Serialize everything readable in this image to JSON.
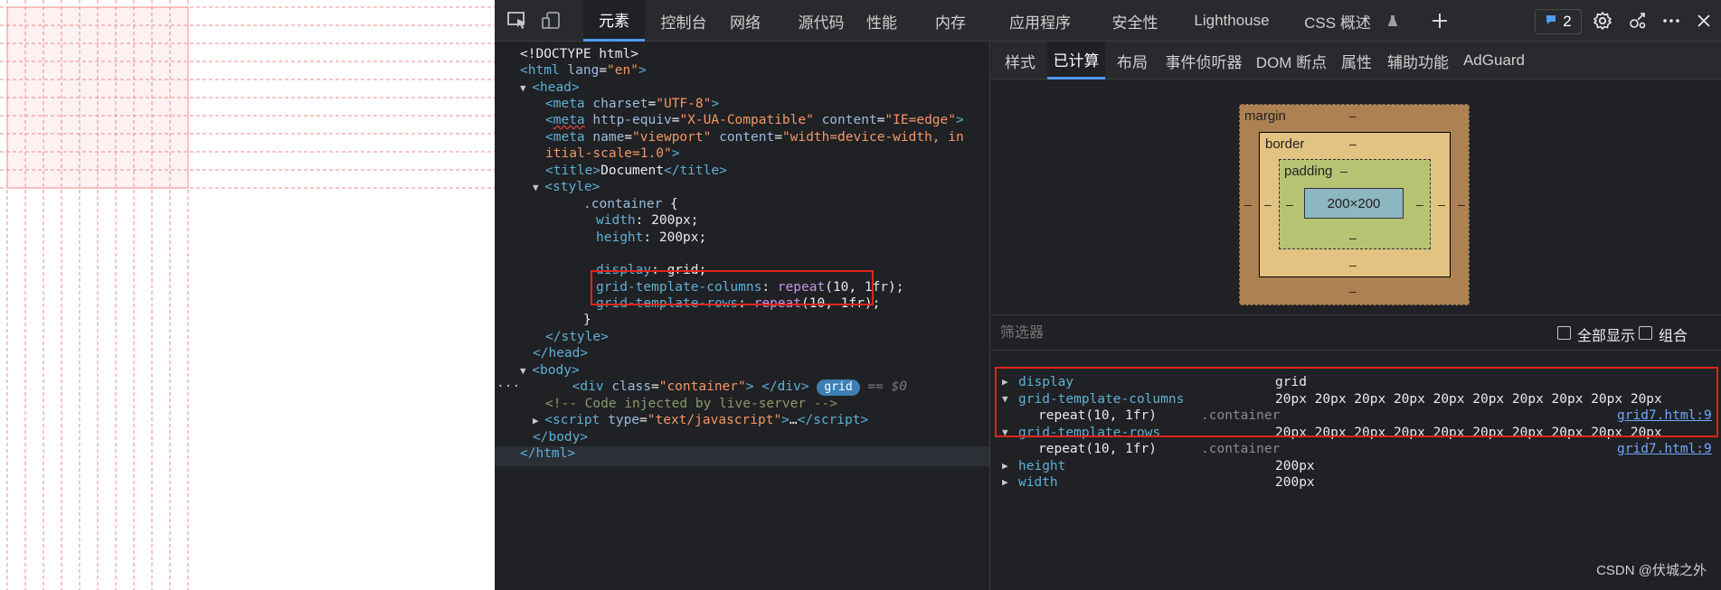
{
  "toolbar": {
    "tabs": [
      "元素",
      "控制台",
      "网络",
      "源代码",
      "性能",
      "内存",
      "应用程序",
      "安全性",
      "Lighthouse",
      "CSS 概述"
    ],
    "active_tab": "元素",
    "issues_count": "2"
  },
  "computed_tabs": [
    "样式",
    "已计算",
    "布局",
    "事件侦听器",
    "DOM 断点",
    "属性",
    "辅助功能",
    "AdGuard"
  ],
  "code": {
    "doctype": "<!DOCTYPE html>",
    "html_open": "html",
    "lang_attr": "lang",
    "lang_val": "\"en\"",
    "head": "head",
    "meta": "meta",
    "charset": "charset",
    "charset_val": "\"UTF-8\"",
    "http_equiv": "http-equiv",
    "http_equiv_val": "\"X-UA-Compatible\"",
    "content": "content",
    "content_val": "\"IE=edge\"",
    "name": "name",
    "name_val": "\"viewport\"",
    "viewport_content_a": "\"width=device-width, in",
    "viewport_content_b": "itial-scale=1.0\"",
    "title": "title",
    "title_text": "Document",
    "style": "style",
    "selector": ".container",
    "width_prop": "width",
    "width_val": "200px",
    "height_prop": "height",
    "height_val": "200px",
    "display_prop": "display",
    "display_val": "grid",
    "gtc_prop": "grid-template-columns",
    "gtr_prop": "grid-template-rows",
    "repeat_fn": "repeat",
    "repeat_args": "(10, 1fr)",
    "body": "body",
    "div": "div",
    "class_attr": "class",
    "class_val": "\"container\"",
    "grid_badge": "grid",
    "eq0": "== $0",
    "comment": "<!-- Code injected by live-server -->",
    "script": "script",
    "type_attr": "type",
    "type_val": "\"text/javascript\"",
    "ellipsis": "…"
  },
  "box_model": {
    "margin_label": "margin",
    "border_label": "border",
    "padding_label": "padding",
    "content_size": "200×200",
    "dash": "–"
  },
  "filter": {
    "placeholder": "筛选器",
    "show_all": "全部显示",
    "group": "组合"
  },
  "computed_props": [
    {
      "name": "display",
      "value": "grid"
    },
    {
      "name": "grid-template-columns",
      "value": "20px 20px 20px 20px 20px 20px 20px 20px 20px 20px",
      "source_value": "repeat(10, 1fr)",
      "source_selector": ".container",
      "source_link": "grid7.html:9"
    },
    {
      "name": "grid-template-rows",
      "value": "20px 20px 20px 20px 20px 20px 20px 20px 20px 20px",
      "source_value": "repeat(10, 1fr)",
      "source_selector": ".container",
      "source_link": "grid7.html:9"
    },
    {
      "name": "height",
      "value": "200px"
    },
    {
      "name": "width",
      "value": "200px"
    }
  ],
  "watermark": "CSDN @伏城之外",
  "colors": {
    "accent": "#4e9bf0",
    "highlight_box": "#e0251b",
    "grid_line": "#f08b8b"
  }
}
